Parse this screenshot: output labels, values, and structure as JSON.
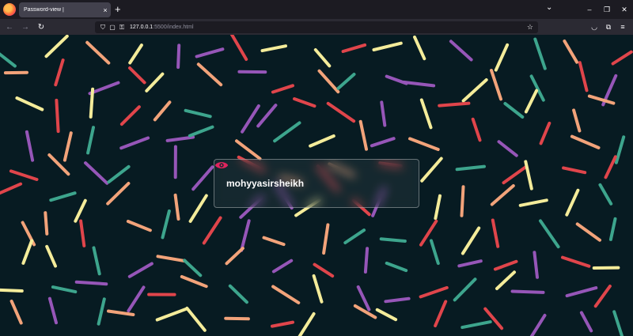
{
  "browser": {
    "tab_title": "Password-view |",
    "tab_close": "×",
    "new_tab": "+",
    "tab_list": "⌄",
    "window": {
      "minimize": "–",
      "restore": "❐",
      "close": "✕"
    },
    "nav": {
      "back": "←",
      "forward": "→",
      "reload": "↻"
    },
    "url_host": "127.0.0.1",
    "url_path": ":5500/index.html",
    "icons": {
      "shield": "⛉",
      "page": "▢",
      "key": "⚿",
      "star": "☆",
      "pocket": "◡",
      "extensions": "⧉",
      "menu": "≡"
    }
  },
  "page": {
    "password_value": "mohyyasirsheikh",
    "eye_icon_color": "#e0245e",
    "background_color": "#071b22",
    "stick_colors": [
      "#e0454b",
      "#f2a37a",
      "#f4ec9a",
      "#3da58d",
      "#9656b8"
    ]
  }
}
